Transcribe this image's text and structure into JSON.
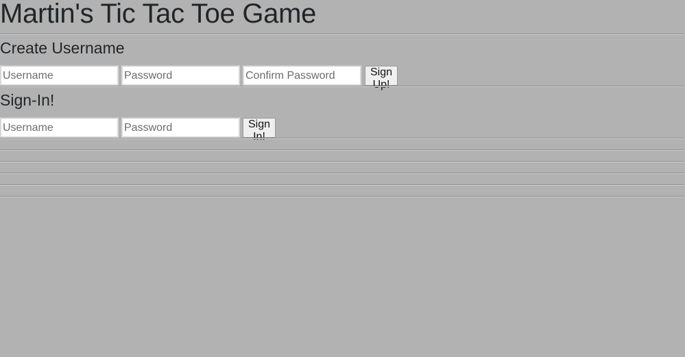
{
  "header": {
    "title": "Martin's Tic Tac Toe Game"
  },
  "signup": {
    "heading": "Create Username",
    "username_placeholder": "Username",
    "password_placeholder": "Password",
    "confirm_placeholder": "Confirm Password",
    "submit_label": "Sign Up!"
  },
  "signin": {
    "heading": "Sign-In!",
    "username_placeholder": "Username",
    "password_placeholder": "Password",
    "submit_label": "Sign In!"
  },
  "colors": {
    "background": "#b2b2b2",
    "text": "#212529"
  }
}
